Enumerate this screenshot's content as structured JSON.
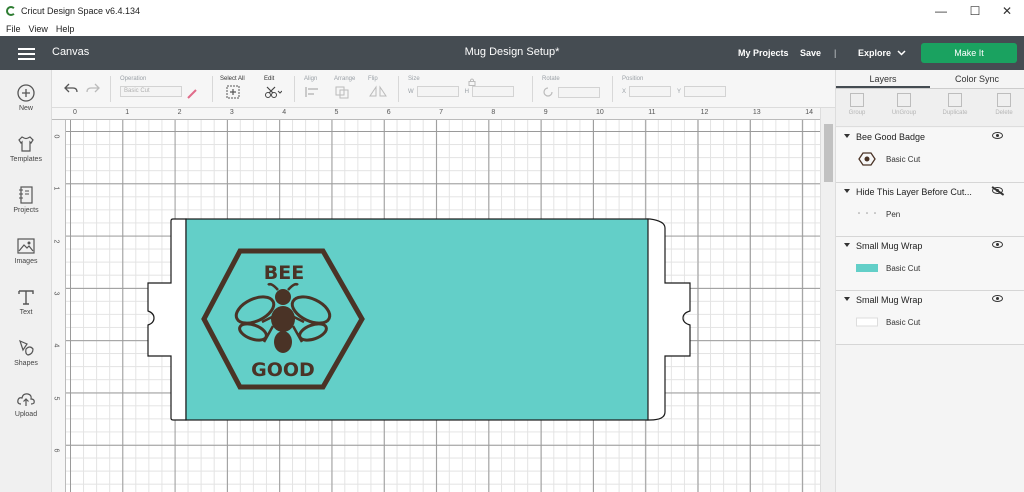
{
  "window": {
    "title": "Cricut Design Space  v6.4.134",
    "minimize": "—",
    "maximize": "☐",
    "close": "✕"
  },
  "menu": [
    "File",
    "View",
    "Help"
  ],
  "header": {
    "canvas_label": "Canvas",
    "document_title": "Mug Design Setup*",
    "my_projects": "My Projects",
    "save": "Save",
    "separator": "|",
    "explore": "Explore",
    "make_it": "Make It",
    "colors": {
      "bar": "#454c52",
      "make_it": "#1aa260"
    }
  },
  "toolbar": {
    "operation_label": "Operation",
    "operation_value": "Basic Cut",
    "select_all_label": "Select All",
    "edit_label": "Edit",
    "align_label": "Align",
    "arrange_label": "Arrange",
    "flip_label": "Flip",
    "size_label": "Size",
    "size_w": "W",
    "size_h": "H",
    "rotate_label": "Rotate",
    "position_label": "Position",
    "pos_x": "X",
    "pos_y": "Y"
  },
  "sidebar": {
    "items": [
      {
        "label": "New",
        "icon": "plus-circle-icon"
      },
      {
        "label": "Templates",
        "icon": "shirt-icon"
      },
      {
        "label": "Projects",
        "icon": "notebook-icon"
      },
      {
        "label": "Images",
        "icon": "image-icon"
      },
      {
        "label": "Text",
        "icon": "text-icon"
      },
      {
        "label": "Shapes",
        "icon": "shapes-icon"
      },
      {
        "label": "Upload",
        "icon": "upload-cloud-icon"
      }
    ]
  },
  "ruler": {
    "top": [
      "0",
      "1",
      "2",
      "3",
      "4",
      "5",
      "6",
      "7",
      "8",
      "9",
      "10",
      "11",
      "12",
      "13",
      "14"
    ],
    "left": [
      "0",
      "1",
      "2",
      "3",
      "4",
      "5",
      "6"
    ]
  },
  "canvas": {
    "badge_text_top": "BEE",
    "badge_text_bottom": "GOOD",
    "colors": {
      "wrap": "#63cfc8",
      "badge": "#4a3326",
      "outline": "#1a1a1a"
    }
  },
  "panel": {
    "tabs": [
      "Layers",
      "Color Sync"
    ],
    "actions": [
      "Group",
      "UnGroup",
      "Duplicate",
      "Delete"
    ],
    "layers": [
      {
        "name": "Bee Good Badge",
        "child": "Basic Cut",
        "visible": true,
        "thumb": "bee-badge"
      },
      {
        "name": "Hide This Layer Before Cut...",
        "child": "Pen",
        "visible": false,
        "thumb": "dots"
      },
      {
        "name": "Small Mug Wrap",
        "child": "Basic Cut",
        "visible": true,
        "thumb": "teal-rect"
      },
      {
        "name": "Small Mug Wrap",
        "child": "Basic Cut",
        "visible": true,
        "thumb": "white-rect"
      }
    ],
    "thumb_colors": {
      "teal": "#63cfc8",
      "white": "#ffffff"
    }
  }
}
